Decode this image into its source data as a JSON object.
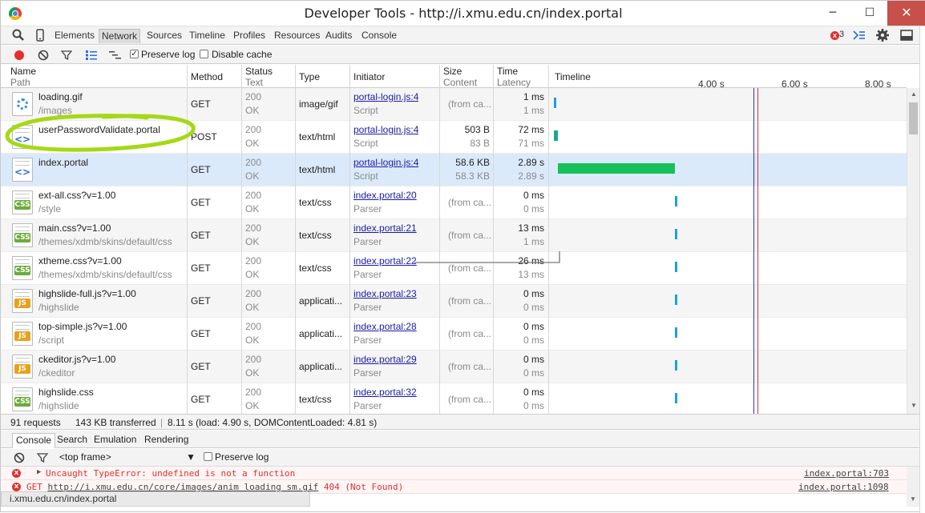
{
  "window": {
    "title": "Developer Tools - http://i.xmu.edu.cn/index.portal",
    "minimize": "─",
    "maximize": "☐",
    "close": "✕"
  },
  "devtools": {
    "panels": [
      "Elements",
      "Network",
      "Sources",
      "Timeline",
      "Profiles",
      "Resources",
      "Audits",
      "Console"
    ],
    "active_panel": "Network",
    "error_count": "3"
  },
  "network_toolbar": {
    "preserve_log_label": "Preserve log",
    "preserve_log_checked": true,
    "disable_cache_label": "Disable cache",
    "disable_cache_checked": false
  },
  "columns": {
    "name": "Name",
    "path": "Path",
    "method": "Method",
    "status": "Status",
    "status_text": "Text",
    "type": "Type",
    "initiator": "Initiator",
    "size": "Size",
    "content": "Content",
    "time": "Time",
    "latency": "Latency",
    "timeline": "Timeline"
  },
  "timeline_ticks": [
    "4.00 s",
    "6.00 s",
    "8.00 s"
  ],
  "requests": [
    {
      "name": "loading.gif",
      "path": "/images",
      "method": "GET",
      "status": "200",
      "status_text": "OK",
      "type": "image/gif",
      "initiator": "portal-login.js:4",
      "initiator_type": "Script",
      "size": "(from ca...",
      "content": "",
      "time": "1 ms",
      "latency": "1 ms",
      "icon": "spinner-icon",
      "bar_start_s": 0.02,
      "bar_end_s": 0.08,
      "bar_color": "#1ba1e2"
    },
    {
      "name": "userPasswordValidate.portal",
      "path": "",
      "method": "POST",
      "status": "200",
      "status_text": "OK",
      "type": "text/html",
      "initiator": "portal-login.js:4",
      "initiator_type": "Script",
      "size": "503 B",
      "content": "83 B",
      "time": "72 ms",
      "latency": "71 ms",
      "icon": "html-icon",
      "bar_start_s": 0.02,
      "bar_end_s": 0.12,
      "bar_color": "#18a995"
    },
    {
      "name": "index.portal",
      "path": "",
      "method": "GET",
      "status": "200",
      "status_text": "OK",
      "type": "text/html",
      "initiator": "portal-login.js:4",
      "initiator_type": "Script",
      "size": "58.6 KB",
      "content": "58.3 KB",
      "time": "2.89 s",
      "latency": "2.89 s",
      "icon": "html-icon",
      "bar_start_s": 0.12,
      "bar_end_s": 2.93,
      "bar_color": "#16c05a"
    },
    {
      "name": "ext-all.css?v=1.00",
      "path": "/style",
      "method": "GET",
      "status": "200",
      "status_text": "OK",
      "type": "text/css",
      "initiator": "index.portal:20",
      "initiator_type": "Parser",
      "size": "(from ca...",
      "content": "",
      "time": "0 ms",
      "latency": "0 ms",
      "icon": "css-icon",
      "bar_start_s": 2.93,
      "bar_end_s": 2.99,
      "bar_color": "#1ba1e2"
    },
    {
      "name": "main.css?v=1.00",
      "path": "/themes/xdmb/skins/default/css",
      "method": "GET",
      "status": "200",
      "status_text": "OK",
      "type": "text/css",
      "initiator": "index.portal:21",
      "initiator_type": "Parser",
      "size": "(from ca...",
      "content": "",
      "time": "13 ms",
      "latency": "1 ms",
      "icon": "css-icon",
      "bar_start_s": 2.93,
      "bar_end_s": 2.99,
      "bar_color": "#1ba1e2"
    },
    {
      "name": "xtheme.css?v=1.00",
      "path": "/themes/xdmb/skins/default/css",
      "method": "GET",
      "status": "200",
      "status_text": "OK",
      "type": "text/css",
      "initiator": "index.portal:22",
      "initiator_type": "Parser",
      "size": "(from ca...",
      "content": "",
      "time": "26 ms",
      "latency": "13 ms",
      "icon": "css-icon",
      "bar_start_s": 2.93,
      "bar_end_s": 2.99,
      "bar_color": "#1ba1e2"
    },
    {
      "name": "highslide-full.js?v=1.00",
      "path": "/highslide",
      "method": "GET",
      "status": "200",
      "status_text": "OK",
      "type": "applicati...",
      "initiator": "index.portal:23",
      "initiator_type": "Parser",
      "size": "(from ca...",
      "content": "",
      "time": "0 ms",
      "latency": "0 ms",
      "icon": "js-icon",
      "bar_start_s": 2.93,
      "bar_end_s": 2.99,
      "bar_color": "#1ba1e2"
    },
    {
      "name": "top-simple.js?v=1.00",
      "path": "/script",
      "method": "GET",
      "status": "200",
      "status_text": "OK",
      "type": "applicati...",
      "initiator": "index.portal:28",
      "initiator_type": "Parser",
      "size": "(from ca...",
      "content": "",
      "time": "0 ms",
      "latency": "0 ms",
      "icon": "js-icon",
      "bar_start_s": 2.93,
      "bar_end_s": 2.99,
      "bar_color": "#1ba1e2"
    },
    {
      "name": "ckeditor.js?v=1.00",
      "path": "/ckeditor",
      "method": "GET",
      "status": "200",
      "status_text": "OK",
      "type": "applicati...",
      "initiator": "index.portal:29",
      "initiator_type": "Parser",
      "size": "(from ca...",
      "content": "",
      "time": "0 ms",
      "latency": "0 ms",
      "icon": "js-icon",
      "bar_start_s": 2.93,
      "bar_end_s": 2.99,
      "bar_color": "#1ba1e2"
    },
    {
      "name": "highslide.css",
      "path": "/highslide",
      "method": "GET",
      "status": "200",
      "status_text": "OK",
      "type": "text/css",
      "initiator": "index.portal:32",
      "initiator_type": "Parser",
      "size": "(from ca...",
      "content": "",
      "time": "0 ms",
      "latency": "0 ms",
      "icon": "css-icon",
      "bar_start_s": 2.93,
      "bar_end_s": 2.99,
      "bar_color": "#1ba1e2"
    }
  ],
  "timeline_markers": {
    "dom_content_loaded_s": 4.81,
    "load_s": 4.9
  },
  "summary": {
    "requests": "91 requests",
    "transferred": "143 KB transferred",
    "timing": "8.11 s (load: 4.90 s, DOMContentLoaded: 4.81 s)"
  },
  "drawer": {
    "tabs": [
      "Console",
      "Search",
      "Emulation",
      "Rendering"
    ],
    "active_tab": "Console",
    "frame": "<top frame>",
    "preserve_log_label": "Preserve log",
    "messages": [
      {
        "text": "Uncaught TypeError: undefined is not a function",
        "source": "index.portal:703",
        "expandable": true
      },
      {
        "text_prefix": "GET ",
        "url": "http://i.xmu.edu.cn/core/images/anim_loading_sm.gif",
        "text_suffix": " 404 (Not Found)",
        "source": "index.portal:1098"
      }
    ]
  },
  "status_url": "i.xmu.edu.cn/index.portal",
  "colors": {
    "error": "#e0312f",
    "link": "#1a1aa6",
    "selected_row": "#dbeafb",
    "dcl_marker": "#2f2fd8",
    "load_marker": "#e0312f",
    "annotation": "#a6d816"
  }
}
